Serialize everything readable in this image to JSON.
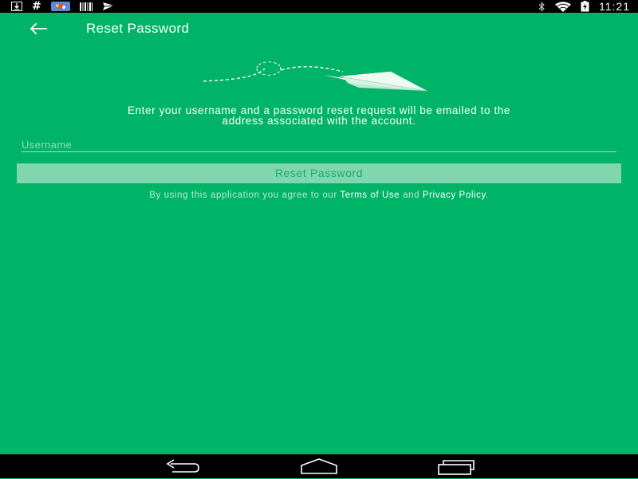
{
  "status_bar": {
    "left_icons": [
      "download-icon",
      "hash-icon",
      "app-notification-icon",
      "barcode-icon",
      "send-icon"
    ],
    "right_icons": [
      "bluetooth-icon",
      "wifi-icon",
      "battery-charging-icon"
    ],
    "hash_glyph": "#",
    "time": "11:21"
  },
  "app_bar": {
    "back_icon": "arrow-back-icon",
    "title": "Reset Password"
  },
  "illustration": {
    "icon": "paper-plane-icon"
  },
  "main": {
    "instructions_line1": "Enter your username and a password reset request will be emailed to the",
    "instructions_line2": "address associated with the account.",
    "username_placeholder": "Username",
    "username_value": "",
    "reset_button_label": "Reset Password",
    "terms_prefix": "By using this application you agree to our ",
    "terms_of_use": "Terms of Use",
    "terms_and": " and ",
    "privacy_policy": "Privacy Policy",
    "terms_suffix": "."
  },
  "nav_bar": {
    "back": "nav-back-icon",
    "home": "nav-home-icon",
    "recents": "nav-recents-icon"
  },
  "colors": {
    "background": "#00b467",
    "button_bg": "#80d6ae",
    "button_text": "#1fa86a",
    "status_bar": "#000000"
  }
}
